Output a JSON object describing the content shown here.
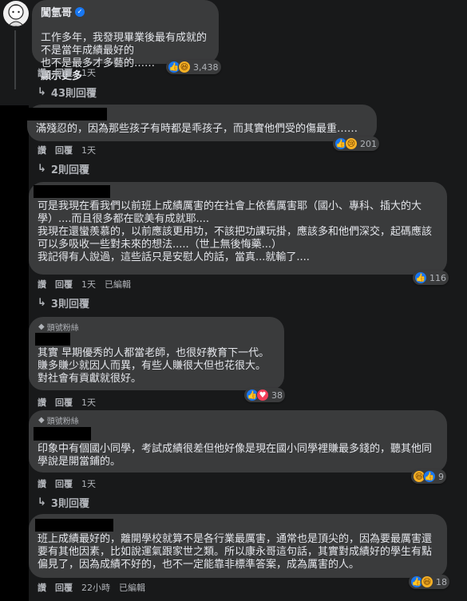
{
  "colors": {
    "background": "#18191a",
    "bubble": "#3a3b3c",
    "text": "#e4e6eb",
    "muted": "#b0b3b8",
    "like": "#1877f2"
  },
  "actions": {
    "like": "讚",
    "reply": "回覆"
  },
  "comments": [
    {
      "author": "闖氫哥",
      "verified": true,
      "text": "工作多年，我發現畢業後最有成就的\n不是當年成績最好的\n也不是最多才多藝的……",
      "more": "顯示更多",
      "reactions": {
        "icons": [
          "like-icon",
          "haha-icon"
        ],
        "count": "3,438"
      },
      "time": "1天",
      "replies": "43則回覆"
    },
    {
      "text": "滿殘忍的，因為那些孩子有時都是乖孩子，而其實他們受的傷最重……",
      "reactions": {
        "icons": [
          "like-icon",
          "sad-icon"
        ],
        "count": "201"
      },
      "time": "1天",
      "replies": "2則回覆"
    },
    {
      "text": "可是我現在看我們以前班上成績厲害的在社會上依舊厲害耶（國小、專科、插大的大學）....而且很多都在歐美有成就耶....\n我現在還蠻羨慕的，以前應該更用功，不該把功課玩掛，應該多和他們深交，起碼應該可以多吸收一些對未來的想法.....（世上無後悔藥...）\n我記得有人說過，這些話只是安慰人的話，當真...就輸了....",
      "reactions": {
        "icons": [
          "like-icon"
        ],
        "count": "116"
      },
      "time": "1天",
      "edited": "已編輯",
      "replies": "3則回覆"
    },
    {
      "badge": "頭號粉絲",
      "text": "其實 早期優秀的人都當老師，也很好教育下一代。\n賺多賺少就因人而異，有些人賺很大但也花很大。\n對社會有貢獻就很好。",
      "reactions": {
        "icons": [
          "like-icon",
          "heart-icon"
        ],
        "count": "38"
      },
      "time": "1天"
    },
    {
      "badge": "頭號粉絲",
      "text": "印象中有個國小同學，考試成績很差但他好像是現在國小同學裡賺最多錢的，聽其他同學說是開當鋪的。",
      "reactions": {
        "icons": [
          "haha-icon",
          "like-icon"
        ],
        "count": "9"
      },
      "time": "1天",
      "replies": "3則回覆"
    },
    {
      "text": "班上成績最好的，離開學校就算不是各行業最厲害，通常也是頂尖的，因為要最厲害還要有其他因素，比如說運氣跟家世之類。所以康永哥這句話，其實對成績好的學生有點偏見了，因為成績不好的，也不一定能靠非標準答案，成為厲害的人。",
      "reactions": {
        "icons": [
          "like-icon",
          "haha-icon"
        ],
        "count": "18"
      },
      "time": "22小時",
      "edited": "已編輯"
    }
  ]
}
